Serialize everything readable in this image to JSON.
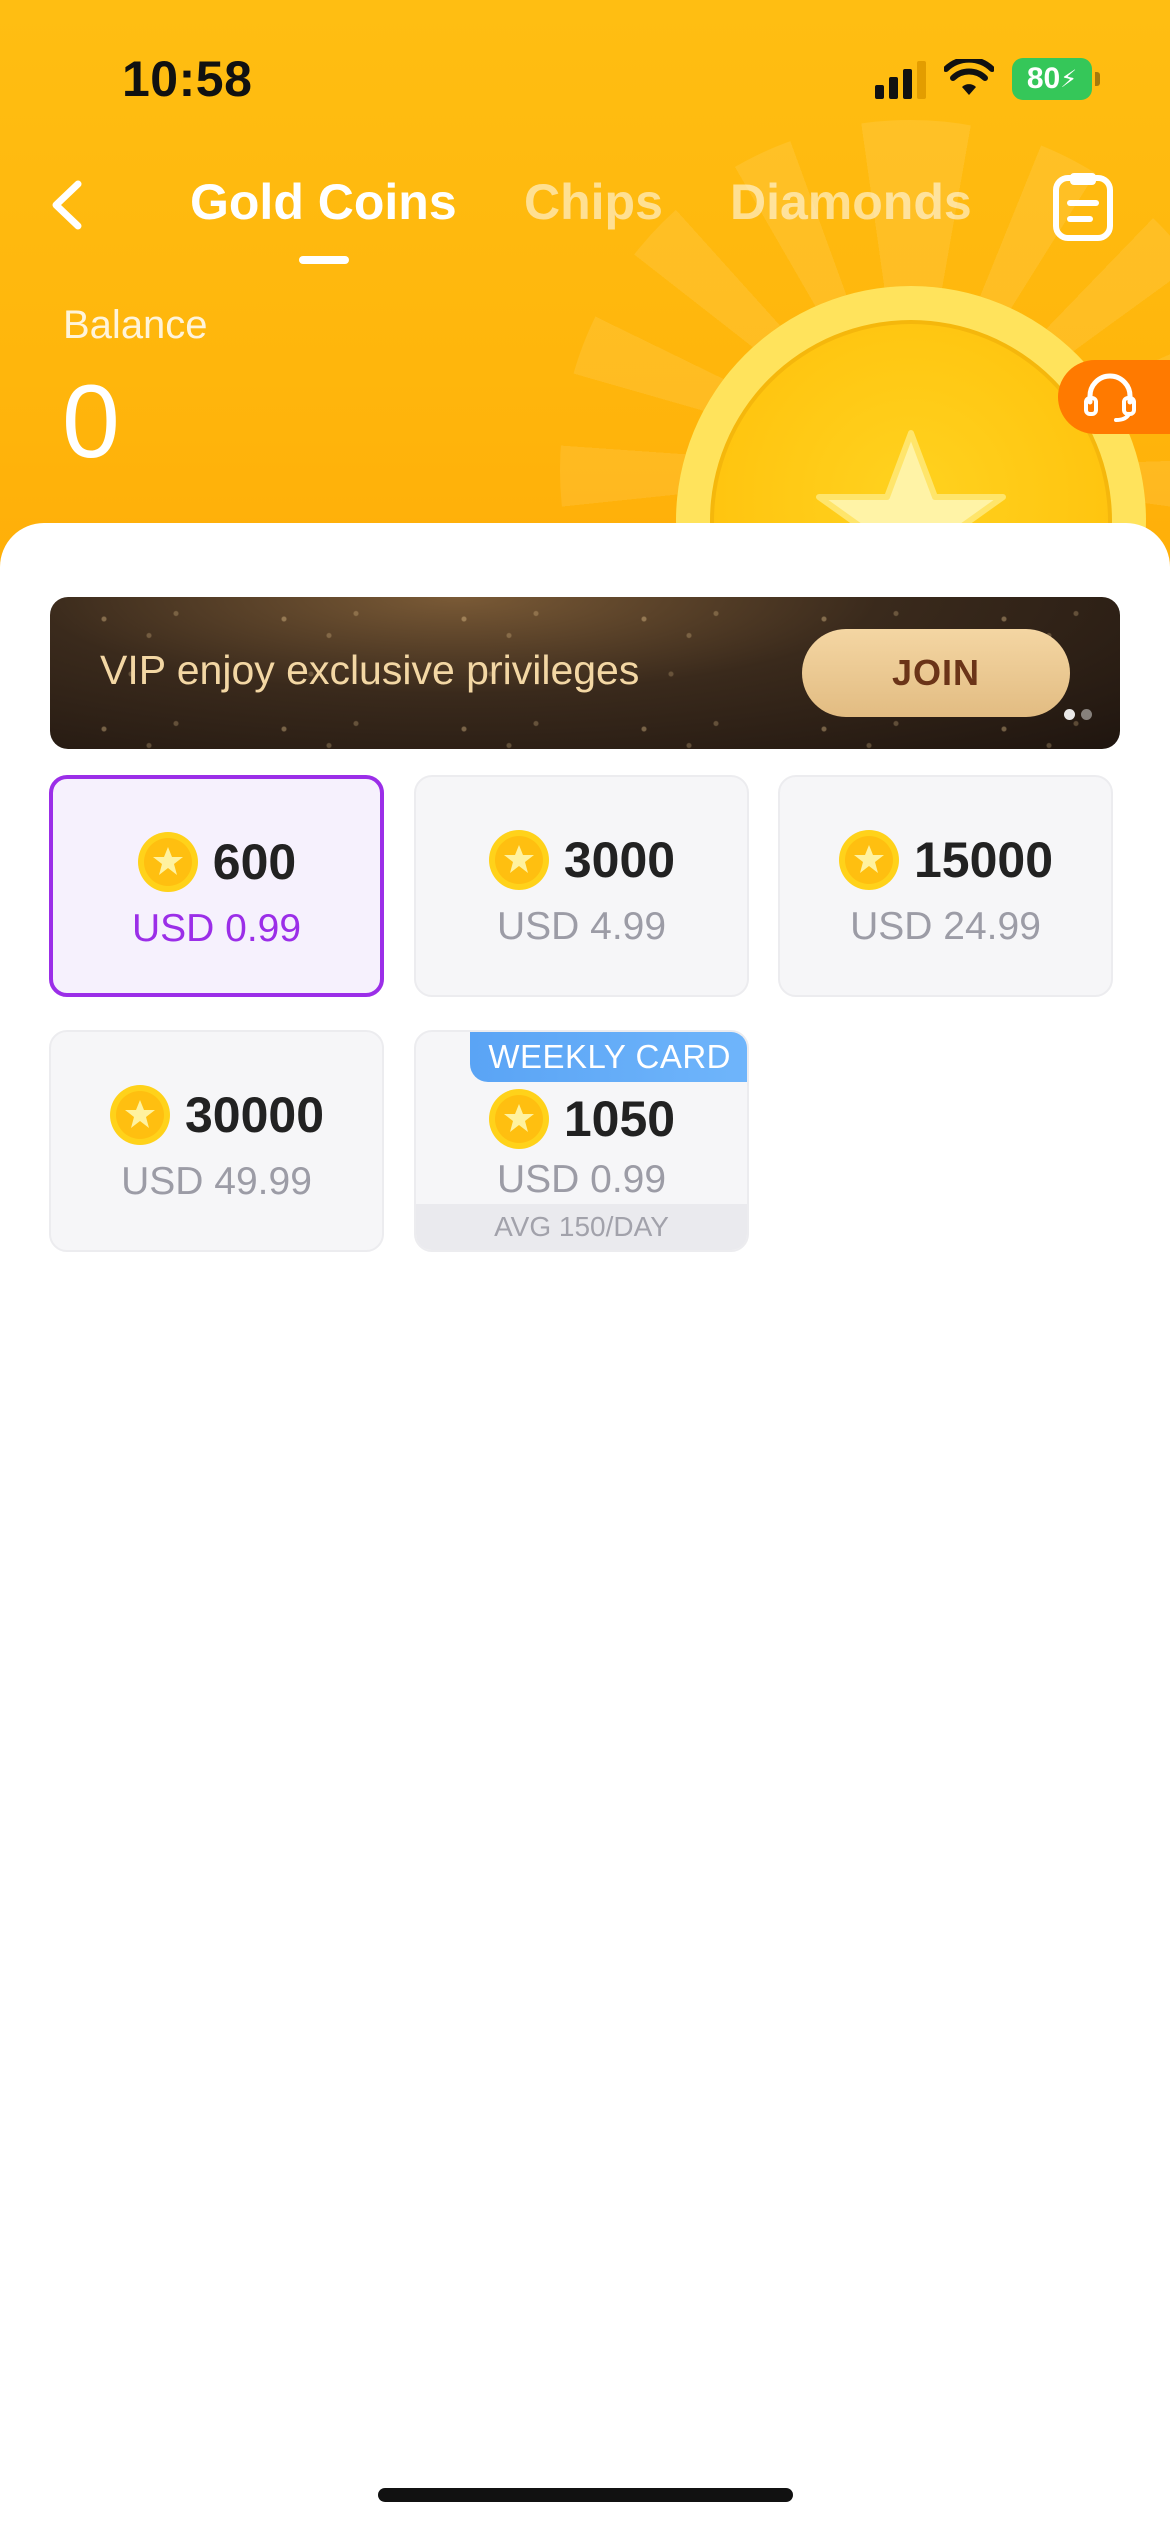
{
  "status_bar": {
    "time": "10:58",
    "battery": "80"
  },
  "nav": {
    "tabs": [
      {
        "label": "Gold Coins",
        "active": true
      },
      {
        "label": "Chips",
        "active": false
      },
      {
        "label": "Diamonds",
        "active": false
      }
    ],
    "icons": {
      "back": "chevron-left-icon",
      "orders": "clipboard-icon",
      "support": "headset-icon"
    }
  },
  "balance": {
    "label": "Balance",
    "value": "0"
  },
  "vip_banner": {
    "text": "VIP enjoy exclusive privileges",
    "button_label": "JOIN",
    "page_count": 2,
    "current_page": 1
  },
  "packages": [
    {
      "amount": "600",
      "price": "USD 0.99",
      "selected": true
    },
    {
      "amount": "3000",
      "price": "USD 4.99",
      "selected": false
    },
    {
      "amount": "15000",
      "price": "USD 24.99",
      "selected": false
    },
    {
      "amount": "30000",
      "price": "USD 49.99",
      "selected": false
    },
    {
      "amount": "1050",
      "price": "USD 0.99",
      "selected": false,
      "badge": "WEEKLY CARD",
      "note": "AVG 150/DAY"
    }
  ],
  "colors": {
    "header": "#ffb60c",
    "selected_accent": "#9b2ee8",
    "support": "#ff7a00",
    "join_text": "#6b3418",
    "weekly_badge": "#5aa4f5"
  }
}
